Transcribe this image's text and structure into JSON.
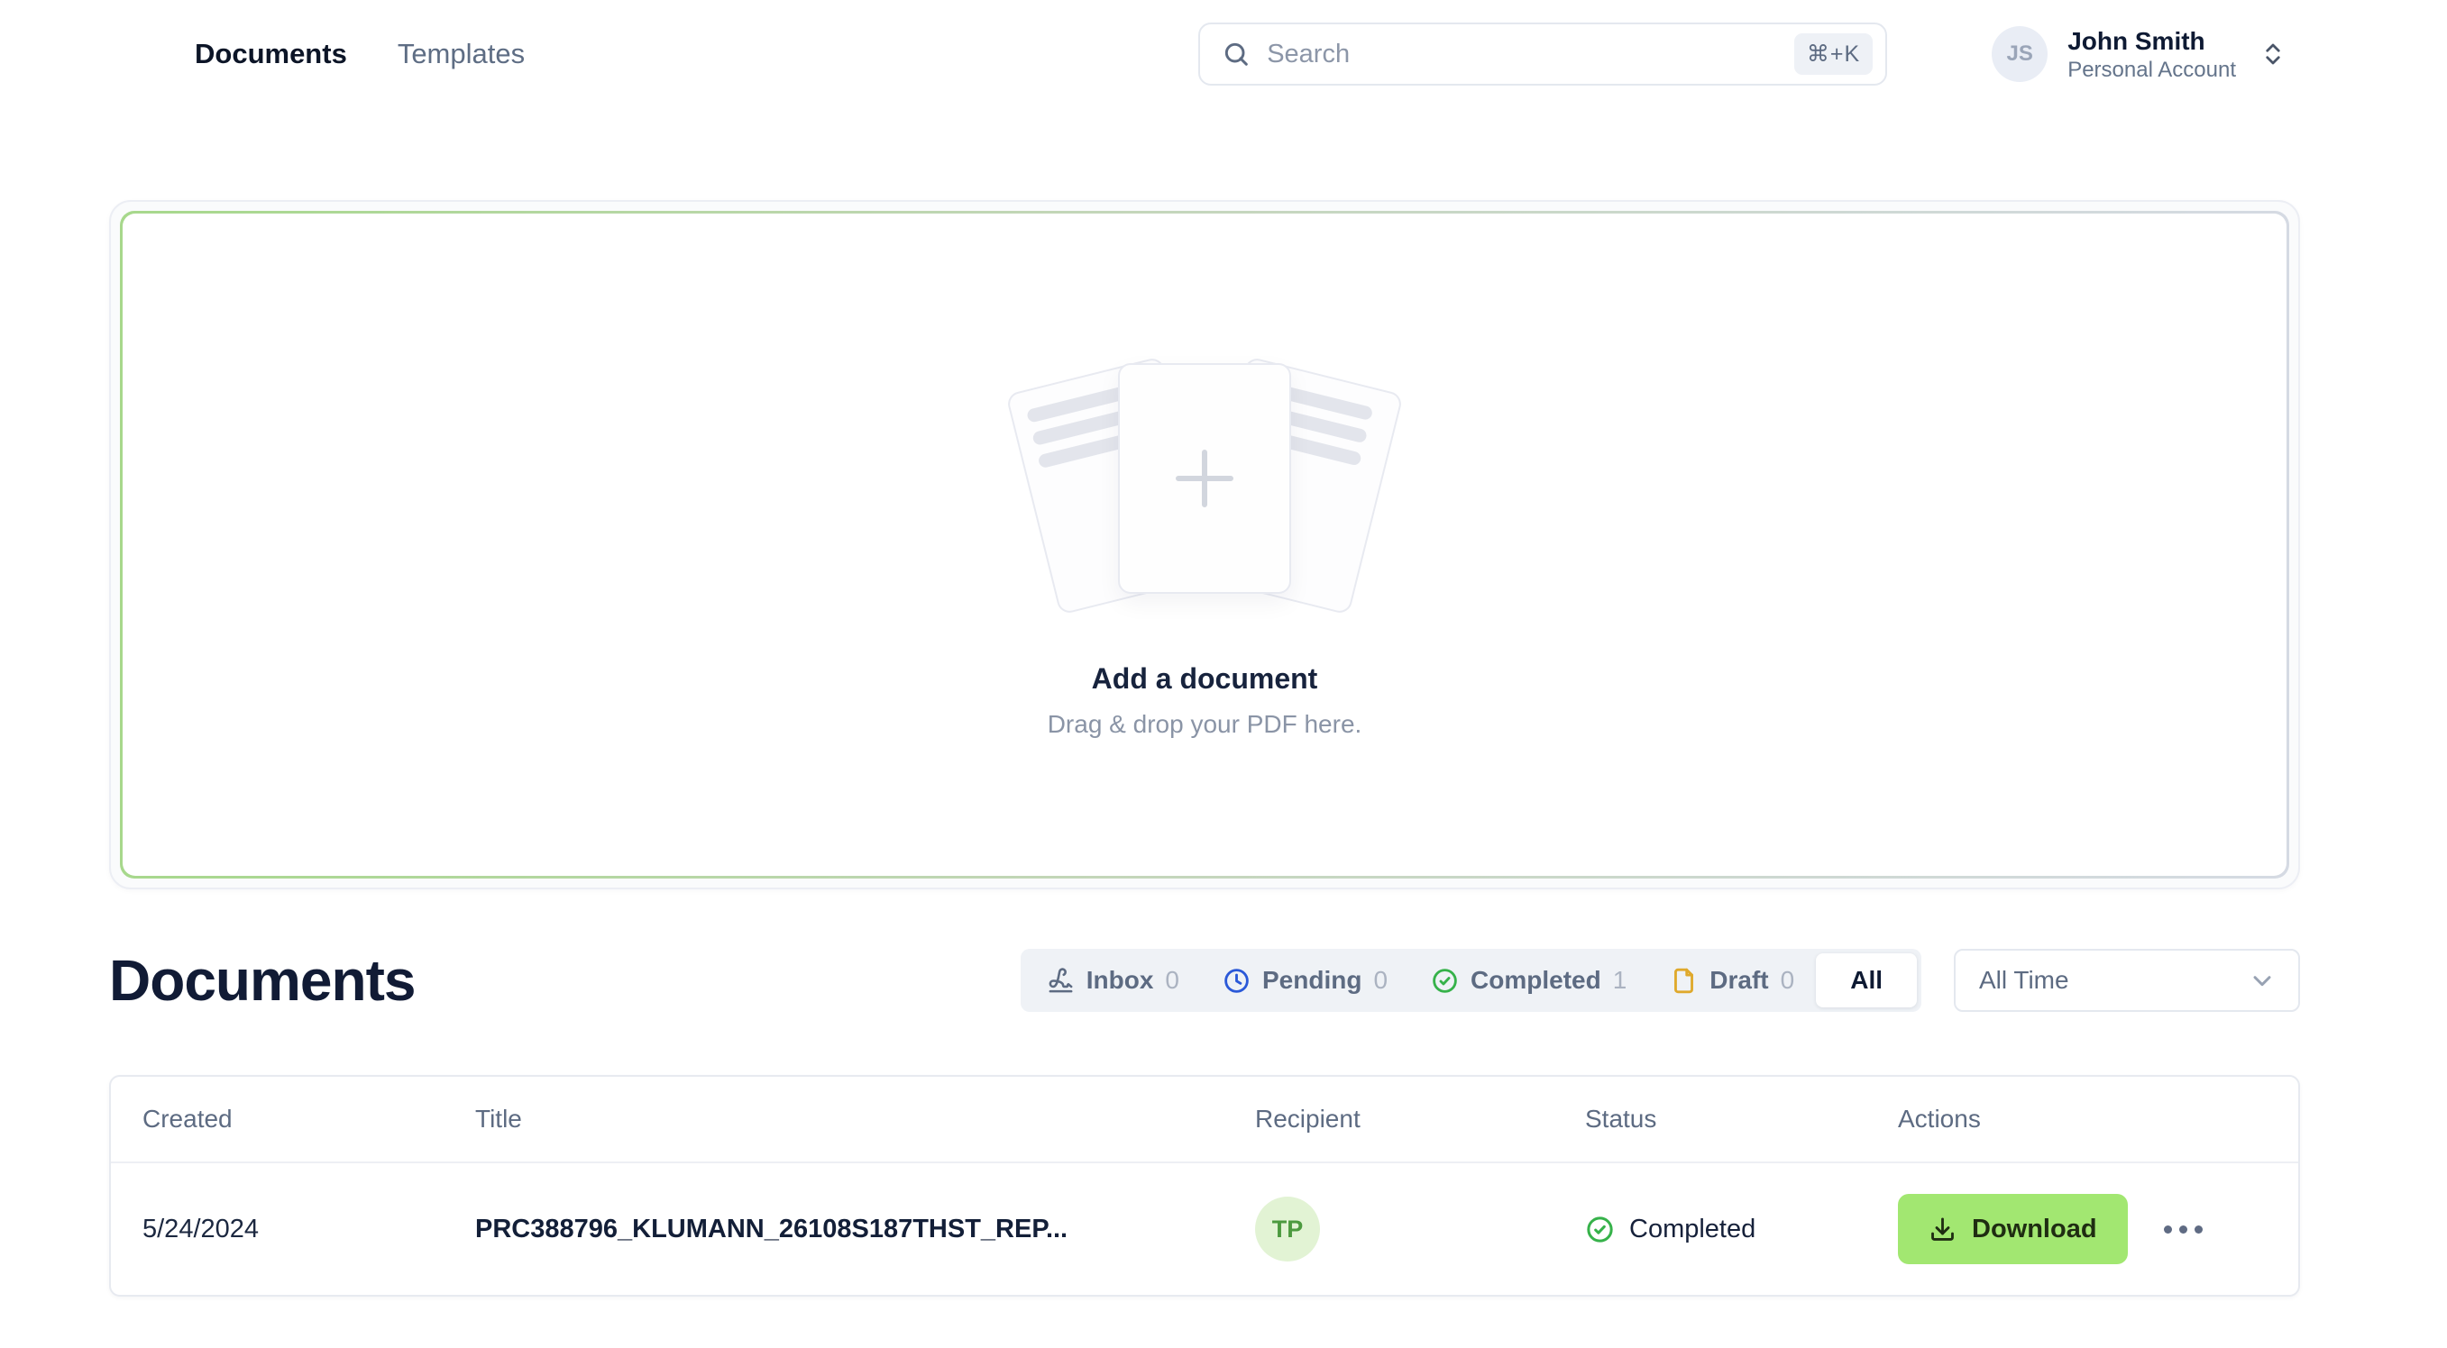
{
  "nav": {
    "items": [
      {
        "label": "Documents",
        "active": true
      },
      {
        "label": "Templates",
        "active": false
      }
    ]
  },
  "search": {
    "placeholder": "Search",
    "shortcut": "⌘+K"
  },
  "account": {
    "initials": "JS",
    "name": "John Smith",
    "type": "Personal Account"
  },
  "dropzone": {
    "title": "Add a document",
    "subtitle": "Drag & drop your PDF here."
  },
  "documents_section": {
    "heading": "Documents",
    "filters": [
      {
        "label": "Inbox",
        "count": "0",
        "icon": "signature-icon"
      },
      {
        "label": "Pending",
        "count": "0",
        "icon": "clock-icon"
      },
      {
        "label": "Completed",
        "count": "1",
        "icon": "check-circle-icon"
      },
      {
        "label": "Draft",
        "count": "0",
        "icon": "file-icon"
      },
      {
        "label": "All",
        "selected": true
      }
    ],
    "period_filter": {
      "value": "All Time"
    }
  },
  "table": {
    "columns": [
      "Created",
      "Title",
      "Recipient",
      "Status",
      "Actions"
    ],
    "rows": [
      {
        "created": "5/24/2024",
        "title": "PRC388796_KLUMANN_26108S187THST_REP...",
        "recipient_initials": "TP",
        "status": "Completed",
        "download_label": "Download"
      }
    ]
  },
  "colors": {
    "brand_green": "#a2e771",
    "status_green": "#36b24a",
    "pending_blue": "#2b59d8",
    "draft_amber": "#dfa92c",
    "recipient_avatar_bg": "#e2f3d4"
  }
}
